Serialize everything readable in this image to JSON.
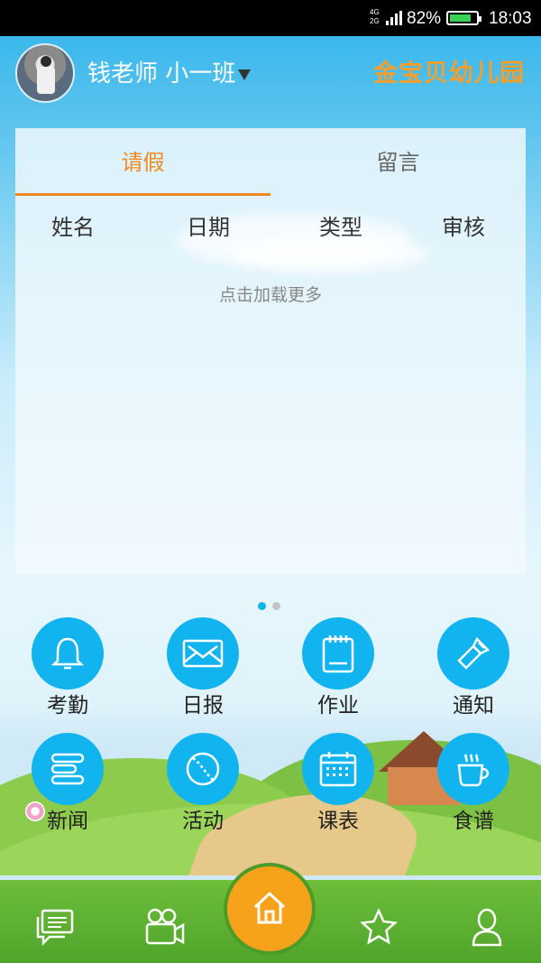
{
  "status_bar": {
    "network_top": "4G",
    "network_bottom": "2G",
    "battery_percent": "82%",
    "battery_level": 0.82,
    "time": "18:03"
  },
  "header": {
    "teacher_name": "钱老师",
    "class_name": "小一班",
    "school_name": "金宝贝幼儿园"
  },
  "card": {
    "tabs": [
      {
        "label": "请假",
        "active": true
      },
      {
        "label": "留言",
        "active": false
      }
    ],
    "columns": [
      "姓名",
      "日期",
      "类型",
      "审核"
    ],
    "load_more": "点击加载更多"
  },
  "pager": {
    "count": 2,
    "active": 0
  },
  "grid": [
    {
      "label": "考勤",
      "icon": "bell-icon"
    },
    {
      "label": "日报",
      "icon": "envelope-icon"
    },
    {
      "label": "作业",
      "icon": "notepad-icon"
    },
    {
      "label": "通知",
      "icon": "flashlight-icon"
    },
    {
      "label": "新闻",
      "icon": "news-list-icon"
    },
    {
      "label": "活动",
      "icon": "ball-icon"
    },
    {
      "label": "课表",
      "icon": "calendar-icon"
    },
    {
      "label": "食谱",
      "icon": "coffee-cup-icon"
    }
  ],
  "bottom_nav": [
    "chat-icon",
    "video-camera-icon",
    "home-icon",
    "star-icon",
    "profile-icon"
  ],
  "colors": {
    "accent_orange": "#f08a20",
    "icon_blue": "#12b4f0",
    "nav_green": "#5cae30",
    "home_orange": "#f6a21a"
  }
}
